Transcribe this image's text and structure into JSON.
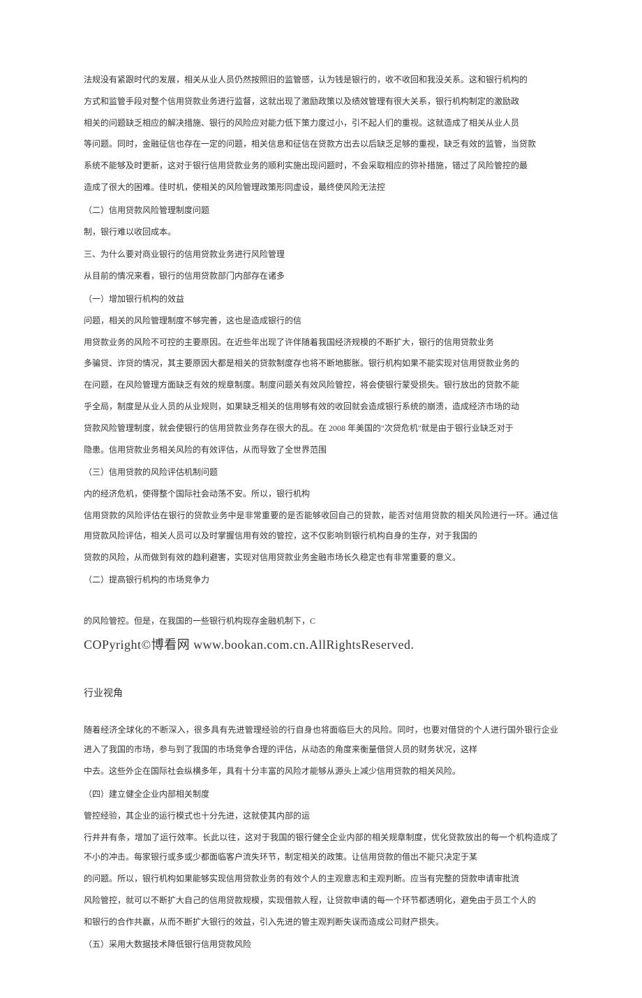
{
  "block1": {
    "p1": "法规没有紧跟时代的发展，相关从业人员仍然按照旧的监管感，认为钱是银行的，收不收回和我没关系。这和银行机构的",
    "p2": "方式和监管手段对整个信用贷款业务进行监督，这就出现了激励政策以及绩效管理有很大关系，银行机构制定的激励政",
    "p3": "相关的问题缺乏相应的解决措施、银行的风险应对能力低下策力度过小，引不起人们的重视。这就造成了相关从业人员",
    "p4": "等问题。同时，金融征信也存在一定的问题，相关信息和征信在贷款方出去以后缺乏足够的重视，缺乏有效的监管，当贷款",
    "p5": "系统不能够及时更新，这对于银行信用贷款业务的顺利实施出现问题时，不会采取相应的弥补措施，错过了风险管控的最",
    "p6": "造成了很大的困难。佳时机，使相关的风险管理政策形同虚设，最终使风险无法控",
    "h1": "（二）信用贷款风险管理制度问题",
    "p7": "制，银行难以收回成本。",
    "h2": "三、为什么要对商业银行的信用贷款业务进行风险管理",
    "p8": "从目前的情况来看，银行的信用贷款部门内部存在诸多",
    "h3": "（一）增加银行机构的效益",
    "p9": "问题，相关的风险管理制度不够完善，这也是造成银行的信",
    "p10": "用贷款业务的风险不可控的主要原因。在近些年出现了许伴随着我国经济规模的不断扩大，银行的信用贷款业务",
    "p11": "多骗贷、诈贷的情况，其主要原因大都是相关的贷款制度存也将不断地膨胀。银行机构如果不能实现对信用贷款业务的",
    "p12": "在问题，在风险管理方面缺乏有效的规章制度。制度问题关有效风险管控，将会使银行蒙受损失。银行放出的贷款不能",
    "p13": "乎全局，制度是从业人员的从业规则，如果缺乏相关的信用够有效的收回就会造成银行系统的崩溃，造成经济市场的动",
    "p14": "贷款风险管理制度，就会使银行的信用贷款业务存在很大的乱。在 2008 年美国的\"次贷危机\"就是由于银行业缺乏对于",
    "p15": "隐患。信用贷款业务相关风险的有效评估，从而导致了全世界范围",
    "h4": "（三）信用贷款的风险评估机制问题",
    "p16": "内的经济危机，使得整个国际社会动荡不安。所以，银行机构",
    "p17": "信用贷款的风险评估在银行的贷款业务中是非常重要的是否能够收回自己的贷款，能否对信用贷款的相关风险进行一环。通过信用贷款风险评估，相关人员可以及时掌握信用有效的管控，这不仅影响到银行机构自身的生存，对于我国的",
    "p18": "贷款的风险，从而做到有效的趋利避害，实现对信用贷款业务金融市场长久稳定也有非常重要的意义。",
    "h5": "（二）提高银行机构的市场竞争力",
    "p19": "的风险管控。但是，在我国的一些银行机构现存金融机制下，C",
    "copyright": "COPyright©博看网 www.bookan.com.cn.AllRightsReserved."
  },
  "block2": {
    "heading": "行业视角",
    "p1": "随着经济全球化的不断深入，很多具有先进管理经验的行自身也将面临巨大的风险。同时，也要对借贷的个人进行国外银行企业进入了我国的市场，参与到了我国的市场竞争合理的评估，从动态的角度来衡量借贷人员的财务状况，这样",
    "p2": "中去。这些外企在国际社会纵横多年，具有十分丰富的风险才能够从源头上减少信用贷款的相关风险。",
    "h1": "（四）建立健全企业内部相关制度",
    "p3": "管控经验，其企业的运行模式也十分先进，这就使其内部的运",
    "p4": "行井井有条，增加了运行效率。长此以往，这对于我国的银行健全企业内部的相关规章制度，优化贷款放出的每一个机构造成了不小的冲击。每家银行或多或少都面临客户流失环节，制定相关的政策。让信用贷款的借出不能只决定于某",
    "p5": "的问题。所以，银行机构如果能够实现信用贷款业务的有效个人的主观意志和主观判断。应当有完整的贷款申请审批流",
    "p6": "风险管控，就可以不断扩大自己的信用贷款规模，实现借款人程，让贷款申请的每一个环节都透明化，避免由于员工个人的",
    "p7": "和银行的合作共赢，从而不断扩大银行的效益，引入先进的管主观判断失误而造成公司财产损失。",
    "h2": "（五）采用大数据技术降低银行信用贷款风险"
  }
}
